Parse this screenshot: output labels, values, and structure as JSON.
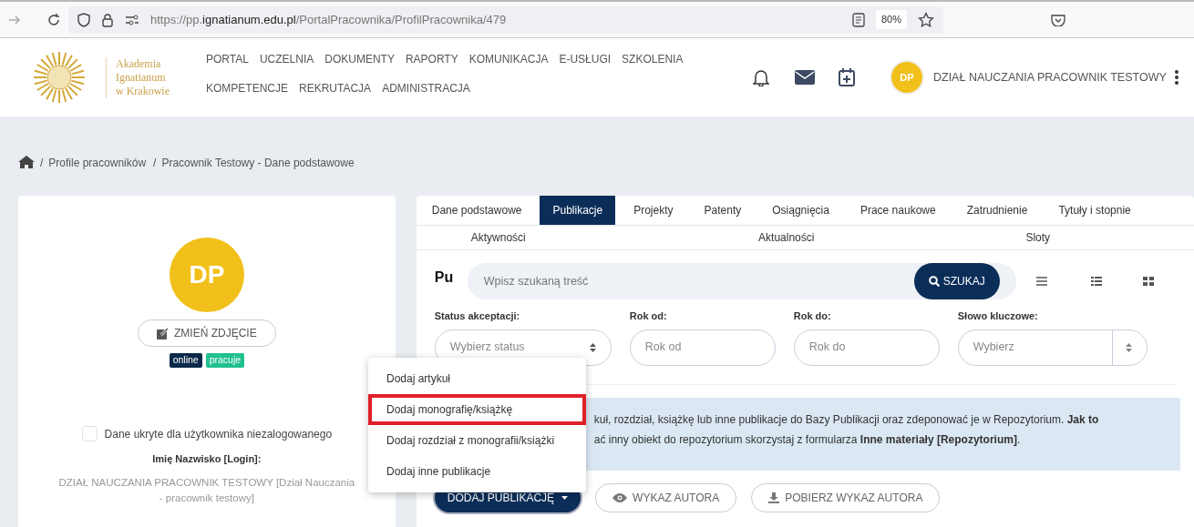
{
  "browser": {
    "url_prefix": "https://pp.",
    "url_domain": "ignatianum.edu.pl",
    "url_path": "/PortalPracownika/ProfilPracownika/479",
    "zoom": "80%"
  },
  "header": {
    "logo_text": [
      "Akademia",
      "Ignatianum",
      "w Krakowie"
    ],
    "menu_rows": [
      [
        "PORTAL",
        "UCZELNIA",
        "DOKUMENTY",
        "RAPORTY",
        "KOMUNIKACJA",
        "E-USŁUGI",
        "SZKOLENIA"
      ],
      [
        "KOMPETENCJE",
        "REKRUTACJA",
        "ADMINISTRACJA"
      ]
    ],
    "user_initials": "DP",
    "user_name": "DZIAŁ NAUCZANIA PRACOWNIK TESTOWY"
  },
  "breadcrumb": [
    "Profile pracowników",
    "Pracownik Testowy - Dane podstawowe"
  ],
  "breadcrumb_separator": "/",
  "profile": {
    "initials": "DP",
    "change_photo": "ZMIEŃ ZDJĘCIE",
    "badges": [
      {
        "label": "online",
        "color": "#0b2a4a"
      },
      {
        "label": "pracuje",
        "color": "#20c08f"
      }
    ],
    "hidden_checkbox": {
      "label": "Dane ukryte dla użytkownika niezalogowanego",
      "checked": false
    },
    "login_label": "Imię Nazwisko [Login]:",
    "login_value": "DZIAŁ NAUCZANIA PRACOWNIK TESTOWY [Dział Nauczania - pracownik testowy]"
  },
  "tabs": [
    {
      "label": "Dane podstawowe",
      "selected": false
    },
    {
      "label": "Publikacje",
      "selected": true
    },
    {
      "label": "Projekty",
      "selected": false
    },
    {
      "label": "Patenty",
      "selected": false
    },
    {
      "label": "Osiągnięcia",
      "selected": false
    },
    {
      "label": "Prace naukowe",
      "selected": false
    },
    {
      "label": "Zatrudnienie",
      "selected": false
    },
    {
      "label": "Tytuły i stopnie",
      "selected": false
    }
  ],
  "tabs_row_2": [
    {
      "label": "Aktywności",
      "selected": false
    },
    {
      "label": "Aktualności",
      "selected": false
    },
    {
      "label": "Sloty",
      "selected": false
    }
  ],
  "section_title": "Pu",
  "search": {
    "placeholder": "Wpisz szukaną treść",
    "button": "SZUKAJ"
  },
  "filters": [
    {
      "label": "Status akceptacji:",
      "kind": "select",
      "placeholder": "Wybierz status"
    },
    {
      "label": "Rok od:",
      "kind": "input",
      "placeholder": "Rok od"
    },
    {
      "label": "Rok do:",
      "kind": "input",
      "placeholder": "Rok do"
    },
    {
      "label": "Słowo kluczowe:",
      "kind": "combo",
      "placeholder": "Wybierz"
    }
  ],
  "info_lines": [
    "kuł, rozdział, książkę lub inne publikacje do Bazy Publikacji oraz zdeponować je w Repozytorium. **Jak to**",
    "ać inny obiekt do repozytorium skorzystaj z formularza **Inne materiały [Repozytorium]**."
  ],
  "buttons": [
    {
      "label": "DODAJ PUBLIKACJĘ",
      "kind": "dropdown"
    },
    {
      "label": "WYKAZ AUTORA",
      "kind": "eye"
    },
    {
      "label": "POBIERZ WYKAZ AUTORA",
      "kind": "download"
    }
  ],
  "dropdown_menu": [
    {
      "label": "Dodaj artykuł",
      "highlighted": false
    },
    {
      "label": "Dodaj monografię/książkę",
      "highlighted": true
    },
    {
      "label": "Dodaj rozdział z monografii/książki",
      "highlighted": false
    },
    {
      "label": "Dodaj inne publikacje",
      "highlighted": false
    }
  ]
}
